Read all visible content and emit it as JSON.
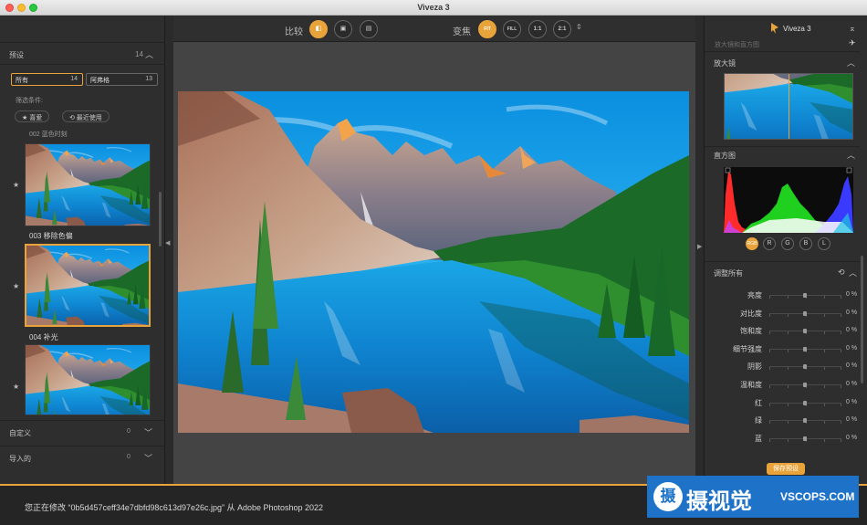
{
  "window": {
    "title": "Viveza 3"
  },
  "left_panel": {
    "presets_label": "预设",
    "presets_count": "14",
    "segments": [
      {
        "label": "所有",
        "count": "14"
      },
      {
        "label": "阿弗格",
        "count": "13"
      }
    ],
    "filter_label": "筛选条件:",
    "filter_pills": [
      "★ 喜爱",
      "⟲ 最近使用"
    ],
    "partial_label": "002 蓝色时刻",
    "thumbnails": [
      {
        "label": "003 移除色偏",
        "selected": false
      },
      {
        "label": "004 补光",
        "selected": true
      },
      {
        "label": "",
        "selected": false
      }
    ],
    "sections": [
      {
        "label": "自定义",
        "count": "0"
      },
      {
        "label": "导入的",
        "count": "0"
      }
    ]
  },
  "toolbar": {
    "compare_label": "比较",
    "focus_label": "变焦",
    "zoom_options": [
      "FIT",
      "FILL",
      "1:1",
      "2:1"
    ],
    "active_zoom": "FIT"
  },
  "right_panel": {
    "brand": "Viveza 3",
    "faded_text": "放大镜和直方图",
    "loupe_label": "放大镜",
    "histogram_label": "直方图",
    "channels": [
      "RGB",
      "R",
      "G",
      "B",
      "L"
    ],
    "active_channel": "RGB",
    "adjust_label": "调整所有",
    "adjustments": [
      {
        "label": "亮度",
        "value": "0 %"
      },
      {
        "label": "对比度",
        "value": "0 %"
      },
      {
        "label": "饱和度",
        "value": "0 %"
      },
      {
        "label": "细节强度",
        "value": "0 %"
      },
      {
        "label": "阴影",
        "value": "0 %"
      },
      {
        "label": "温和度",
        "value": "0 %"
      },
      {
        "label": "红",
        "value": "0 %"
      },
      {
        "label": "绿",
        "value": "0 %"
      },
      {
        "label": "蓝",
        "value": "0 %"
      }
    ],
    "save_label": "保存预设"
  },
  "status": {
    "text": "您正在修改 “0b5d457ceff34e7dbfd98c613d97e26c.jpg” 从 Adobe Photoshop 2022"
  },
  "watermark": {
    "icon_char": "摄",
    "cn": "摄视觉",
    "en": "VSCOPS.COM"
  },
  "colors": {
    "accent": "#e8a33a",
    "panel_bg": "#2e2e2e",
    "canvas_bg": "#444444",
    "watermark_bg": "#1e73c9"
  }
}
